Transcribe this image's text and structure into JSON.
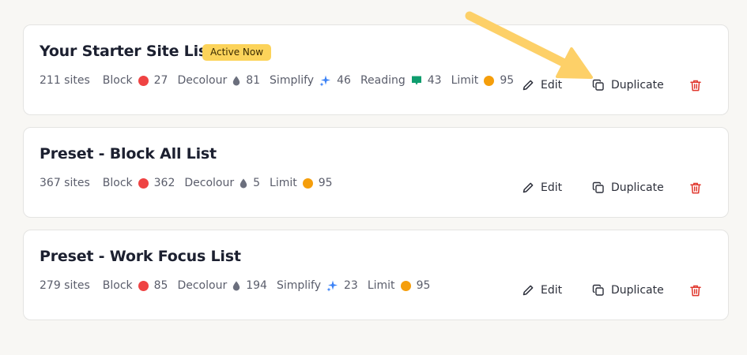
{
  "colors": {
    "page_bg": "#f8f7f4",
    "badge_bg": "#fcd35a",
    "block": "#ef4343",
    "decolour": "#6b6f7d",
    "simplify": "#3b82f6",
    "reading": "#0f9d6e",
    "limit": "#f59e0b",
    "delete": "#e0352b",
    "arrow": "#fdd068"
  },
  "actions": {
    "edit_label": "Edit",
    "duplicate_label": "Duplicate"
  },
  "lists": [
    {
      "title": "Your Starter Site List",
      "badge": "Active Now",
      "sites": "211 sites",
      "stats": [
        {
          "label": "Block",
          "icon": "red-dot-icon",
          "value": "27"
        },
        {
          "label": "Decolour",
          "icon": "droplet-icon",
          "value": "81"
        },
        {
          "label": "Simplify",
          "icon": "sparkle-icon",
          "value": "46"
        },
        {
          "label": "Reading",
          "icon": "reading-icon",
          "value": "43"
        },
        {
          "label": "Limit",
          "icon": "orange-dot-icon",
          "value": "95"
        }
      ]
    },
    {
      "title": "Preset - Block All List",
      "sites": "367 sites",
      "stats": [
        {
          "label": "Block",
          "icon": "red-dot-icon",
          "value": "362"
        },
        {
          "label": "Decolour",
          "icon": "droplet-icon",
          "value": "5"
        },
        {
          "label": "Limit",
          "icon": "orange-dot-icon",
          "value": "95"
        }
      ]
    },
    {
      "title": "Preset - Work Focus List",
      "sites": "279 sites",
      "stats": [
        {
          "label": "Block",
          "icon": "red-dot-icon",
          "value": "85"
        },
        {
          "label": "Decolour",
          "icon": "droplet-icon",
          "value": "194"
        },
        {
          "label": "Simplify",
          "icon": "sparkle-icon",
          "value": "23"
        },
        {
          "label": "Limit",
          "icon": "orange-dot-icon",
          "value": "95"
        }
      ]
    }
  ]
}
